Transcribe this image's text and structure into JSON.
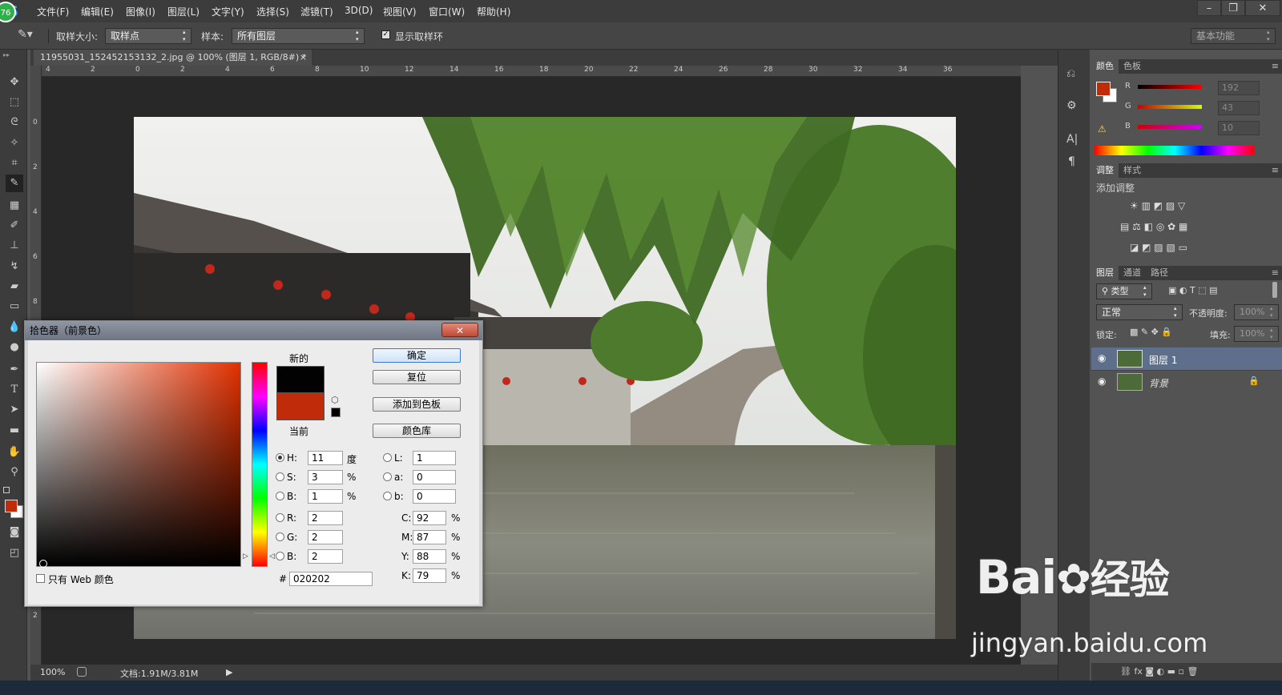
{
  "menubar": {
    "app_logo": "S",
    "badge": "76",
    "items": [
      "文件(F)",
      "编辑(E)",
      "图像(I)",
      "图层(L)",
      "文字(Y)",
      "选择(S)",
      "滤镜(T)",
      "3D(D)",
      "视图(V)",
      "窗口(W)",
      "帮助(H)"
    ],
    "window_controls": [
      "–",
      "❐",
      "✕"
    ]
  },
  "options": {
    "sample_size_label": "取样大小:",
    "sample_size_value": "取样点",
    "sample_label": "样本:",
    "sample_value": "所有图层",
    "show_ring_label": "显示取样环",
    "workspace": "基本功能"
  },
  "document": {
    "tab_title": "11955031_152452153132_2.jpg @ 100% (图层 1, RGB/8#) *",
    "ruler_top": [
      "4",
      "2",
      "0",
      "2",
      "4",
      "6",
      "8",
      "10",
      "12",
      "14",
      "16",
      "18",
      "20",
      "22",
      "24",
      "26",
      "28",
      "30",
      "32",
      "34",
      "36"
    ],
    "ruler_left": [
      "0",
      "2",
      "4",
      "6",
      "8",
      "1",
      "1",
      "1",
      "1",
      "1",
      "2",
      "2"
    ],
    "zoom": "100%",
    "doc_info": "文档:1.91M/3.81M"
  },
  "color_panel": {
    "tabs": [
      "颜色",
      "色板"
    ],
    "channels": [
      {
        "label": "R",
        "value": "192"
      },
      {
        "label": "G",
        "value": "43"
      },
      {
        "label": "B",
        "value": "10"
      }
    ],
    "fg_color": "#c02b0a",
    "bg_color": "#ffffff"
  },
  "adjust_panel": {
    "tabs": [
      "调整",
      "样式"
    ],
    "title": "添加调整"
  },
  "layers_panel": {
    "tabs": [
      "图层",
      "通道",
      "路径"
    ],
    "filter_label": "类型",
    "blend_mode": "正常",
    "opacity_label": "不透明度:",
    "opacity_value": "100%",
    "lock_label": "锁定:",
    "fill_label": "填充:",
    "fill_value": "100%",
    "layers": [
      {
        "name": "图层 1",
        "selected": true
      },
      {
        "name": "背景",
        "selected": false
      }
    ]
  },
  "picker": {
    "title": "拾色器（前景色）",
    "close": "✕",
    "new_label": "新的",
    "current_label": "当前",
    "new_color": "#020202",
    "current_color": "#c02b0a",
    "buttons": {
      "ok": "确定",
      "reset": "复位",
      "add_swatch": "添加到色板",
      "libraries": "颜色库"
    },
    "hsb": [
      {
        "label": "H:",
        "value": "11",
        "unit": "度",
        "on": true
      },
      {
        "label": "S:",
        "value": "3",
        "unit": "%",
        "on": false
      },
      {
        "label": "B:",
        "value": "1",
        "unit": "%",
        "on": false
      }
    ],
    "rgb": [
      {
        "label": "R:",
        "value": "2"
      },
      {
        "label": "G:",
        "value": "2"
      },
      {
        "label": "B:",
        "value": "2"
      }
    ],
    "lab": [
      {
        "label": "L:",
        "value": "1"
      },
      {
        "label": "a:",
        "value": "0"
      },
      {
        "label": "b:",
        "value": "0"
      }
    ],
    "cmyk": [
      {
        "label": "C:",
        "value": "92",
        "unit": "%"
      },
      {
        "label": "M:",
        "value": "87",
        "unit": "%"
      },
      {
        "label": "Y:",
        "value": "88",
        "unit": "%"
      },
      {
        "label": "K:",
        "value": "79",
        "unit": "%"
      }
    ],
    "hex_label": "#",
    "hex_value": "020202",
    "web_only_label": "只有 Web 颜色"
  },
  "watermark": {
    "brand": "Bai",
    "brand2": "经验",
    "url": "jingyan.baidu.com"
  }
}
